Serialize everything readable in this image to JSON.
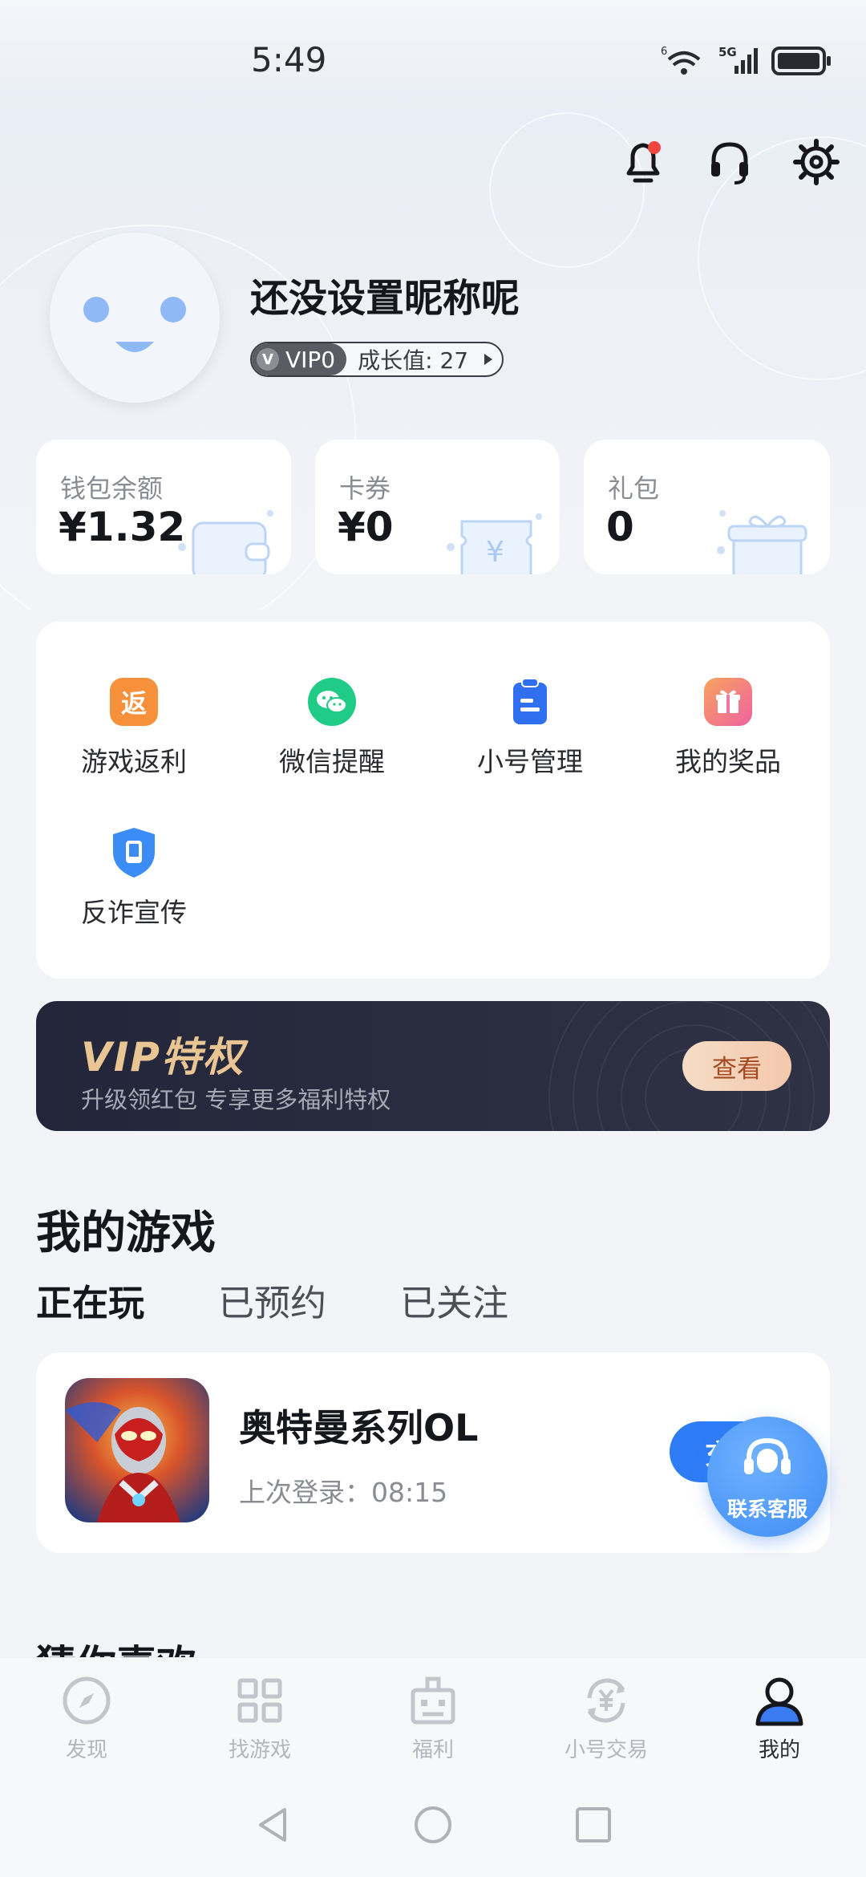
{
  "status_bar": {
    "time": "5:49",
    "wifi_badge": "6",
    "signal_badge": "5G"
  },
  "profile": {
    "nickname": "还没设置昵称呢",
    "vip_level": "VIP0",
    "vip_badge_letter": "V",
    "growth": "成长值: 27"
  },
  "assets": [
    {
      "label": "钱包余额",
      "value": "¥1.32",
      "icon": "wallet-icon"
    },
    {
      "label": "卡券",
      "value": "¥0",
      "icon": "coupon-icon"
    },
    {
      "label": "礼包",
      "value": "0",
      "icon": "gift-box-icon"
    }
  ],
  "coupon_glyph": "¥",
  "menu": [
    {
      "label": "游戏返利",
      "icon": "rebate-icon",
      "glyph": "返",
      "color": "#f7903a"
    },
    {
      "label": "微信提醒",
      "icon": "wechat-icon",
      "color": "#1fcb86"
    },
    {
      "label": "小号管理",
      "icon": "clipboard-icon",
      "color": "#2f6ff0"
    },
    {
      "label": "我的奖品",
      "icon": "prize-gift-icon",
      "color": "#f36b8e"
    },
    {
      "label": "反诈宣传",
      "icon": "shield-phone-icon",
      "color": "#3b8cf5"
    }
  ],
  "vip_banner": {
    "title": "VIP特权",
    "subtitle": "升级领红包 专享更多福利特权",
    "button": "查看"
  },
  "my_games": {
    "title": "我的游戏",
    "tabs": [
      "正在玩",
      "已预约",
      "已关注"
    ],
    "active_tab": 0,
    "game": {
      "name": "奥特曼系列OL",
      "last_login": "上次登录：08:15",
      "button": "充"
    }
  },
  "floating_service": {
    "label": "联系客服"
  },
  "next_section_title": "猜你喜欢",
  "bottom_nav": [
    {
      "label": "发现",
      "icon": "compass-icon"
    },
    {
      "label": "找游戏",
      "icon": "grid-icon"
    },
    {
      "label": "福利",
      "icon": "welfare-icon"
    },
    {
      "label": "小号交易",
      "icon": "trade-icon"
    },
    {
      "label": "我的",
      "icon": "user-icon",
      "active": true
    }
  ],
  "colors": {
    "accent": "#2e7cf6",
    "vip_gold": "#e8c592",
    "vip_dark": "#23253a"
  }
}
